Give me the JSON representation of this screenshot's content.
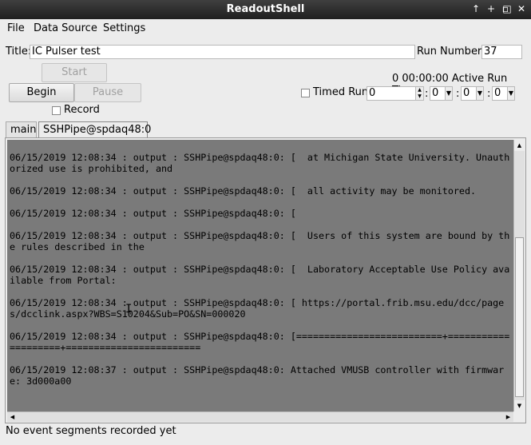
{
  "window": {
    "title": "ReadoutShell",
    "controls": {
      "up": "↑",
      "plus": "+",
      "minimize": "▫",
      "maximize": "□",
      "close": "✕"
    }
  },
  "menu": [
    "File",
    "Data Source",
    "Settings"
  ],
  "title_label": "Title:",
  "title_value": "IC Pulser test",
  "run_label": "Run Number:",
  "run_value": "37",
  "buttons": {
    "start": "Start",
    "begin": "Begin",
    "pause": "Pause"
  },
  "record_label": "Record",
  "active_run_time": "0 00:00:00 Active Run Time",
  "timed_run_label": "Timed Run",
  "timed": {
    "days": "0",
    "hours": "0",
    "minutes": "0",
    "seconds": "0",
    "sep": ":"
  },
  "tabs": [
    "main",
    "SSHPipe@spdaq48:0"
  ],
  "output_lines": [
    "06/15/2019 12:08:34 : output : SSHPipe@spdaq48:0: [  at Michigan State University. Unauthorized use is prohibited, and",
    "06/15/2019 12:08:34 : output : SSHPipe@spdaq48:0: [  all activity may be monitored.",
    "06/15/2019 12:08:34 : output : SSHPipe@spdaq48:0: [",
    "06/15/2019 12:08:34 : output : SSHPipe@spdaq48:0: [  Users of this system are bound by the rules described in the",
    "06/15/2019 12:08:34 : output : SSHPipe@spdaq48:0: [  Laboratory Acceptable Use Policy available from Portal:",
    "06/15/2019 12:08:34 : output : SSHPipe@spdaq48:0: [ https://portal.frib.msu.edu/dcc/pages/dcclink.aspx?WBS=S10204&Sub=PO&SN=000020",
    "06/15/2019 12:08:34 : output : SSHPipe@spdaq48:0: [==========================+====================+========================",
    "06/15/2019 12:08:37 : output : SSHPipe@spdaq48:0: Attached VMUSB controller with firmware: 3d000a00"
  ],
  "status": "No event segments recorded yet",
  "icons": {
    "ibeam": "I"
  },
  "colors": {
    "titlebar": "#2b2b2b",
    "output_bg": "#7a7a7a"
  }
}
